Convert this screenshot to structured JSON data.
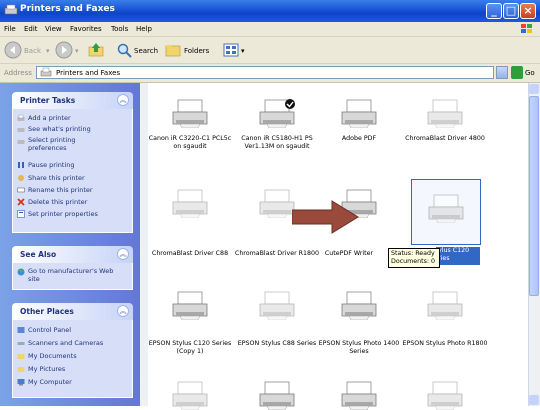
{
  "window": {
    "title": "Printers and Faxes"
  },
  "menu": [
    "File",
    "Edit",
    "View",
    "Favorites",
    "Tools",
    "Help"
  ],
  "toolbar": {
    "back": "Back",
    "search": "Search",
    "folders": "Folders"
  },
  "address": {
    "label": "Address",
    "value": "Printers and Faxes",
    "go": "Go"
  },
  "printer_tasks": {
    "title": "Printer Tasks",
    "items": [
      "Add a printer",
      "See what's printing",
      "Select printing preferences",
      "Pause printing",
      "Share this printer",
      "Rename this printer",
      "Delete this printer",
      "Set printer properties"
    ]
  },
  "see_also": {
    "title": "See Also",
    "items": [
      "Go to manufacturer's Web site"
    ]
  },
  "other_places": {
    "title": "Other Places",
    "items": [
      "Control Panel",
      "Scanners and Cameras",
      "My Documents",
      "My Pictures",
      "My Computer"
    ]
  },
  "printers": [
    "Canon iR C3220-C1 PCL5c on sgaudit",
    "Canon iR C5180-H1 PS Ver1.13M on sgaudit",
    "Adobe PDF",
    "ChromaBlast Driver 4800",
    "ChromaBlast Driver C88",
    "ChromaBlast Driver R1800",
    "CutePDF Writer",
    "EPSON Stylus C120 Series",
    "EPSON Stylus C120 Series (Copy 1)",
    "EPSON Stylus C88 Series",
    "EPSON Stylus Photo 1400 Series",
    "EPSON Stylus Photo R1800"
  ],
  "selected_partial_label": "ylus C120",
  "selected_partial_label_2": "ries",
  "tooltip": {
    "line1": "Status: Ready",
    "line2": "Documents: 0"
  },
  "colors": {
    "titlebar": "#0d45c8",
    "arrow": "#9a4a3a",
    "selection": "#3168c6",
    "pane": "#6f8fe0"
  }
}
